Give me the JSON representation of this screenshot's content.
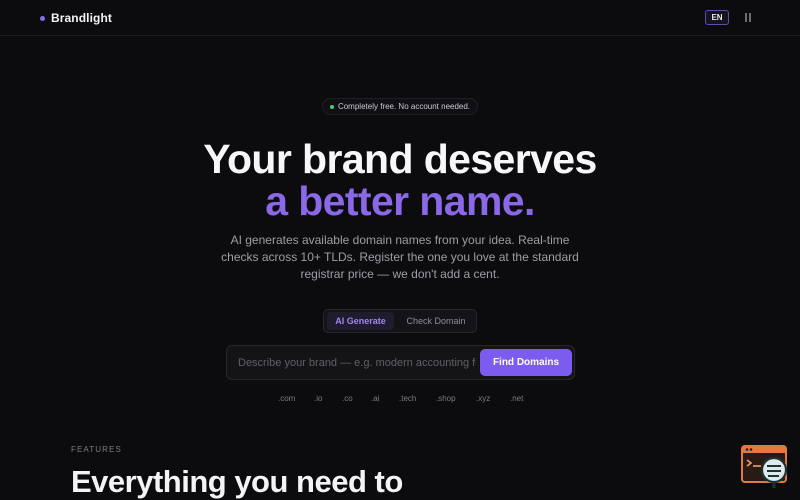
{
  "header": {
    "brand_name": "Brandlight",
    "language_label": "EN"
  },
  "hero": {
    "badge_text": "Completely free. No account needed.",
    "title_line1": "Your brand deserves",
    "title_line2": "a better name.",
    "subtitle": "AI generates available domain names from your idea. Real-time checks across 10+ TLDs. Register the one you love at the standard registrar price — we don't add a cent."
  },
  "tabs": [
    {
      "label": "AI Generate",
      "active": true
    },
    {
      "label": "Check Domain",
      "active": false
    }
  ],
  "search": {
    "placeholder": "Describe your brand — e.g. modern accounting for",
    "button_label": "Find Domains"
  },
  "tlds": [
    ".com",
    ".io",
    ".co",
    ".ai",
    ".tech",
    ".shop",
    ".xyz",
    ".net"
  ],
  "features": {
    "label": "FEATURES",
    "title": "Everything you need to"
  },
  "colors": {
    "accent": "#7c5cf0",
    "accent_text": "#8b68e8",
    "status_green": "#3ed07a",
    "background": "#0c0c0f"
  },
  "icons": {
    "pause": "pause-icon",
    "widget": "chat-widget-icon"
  }
}
